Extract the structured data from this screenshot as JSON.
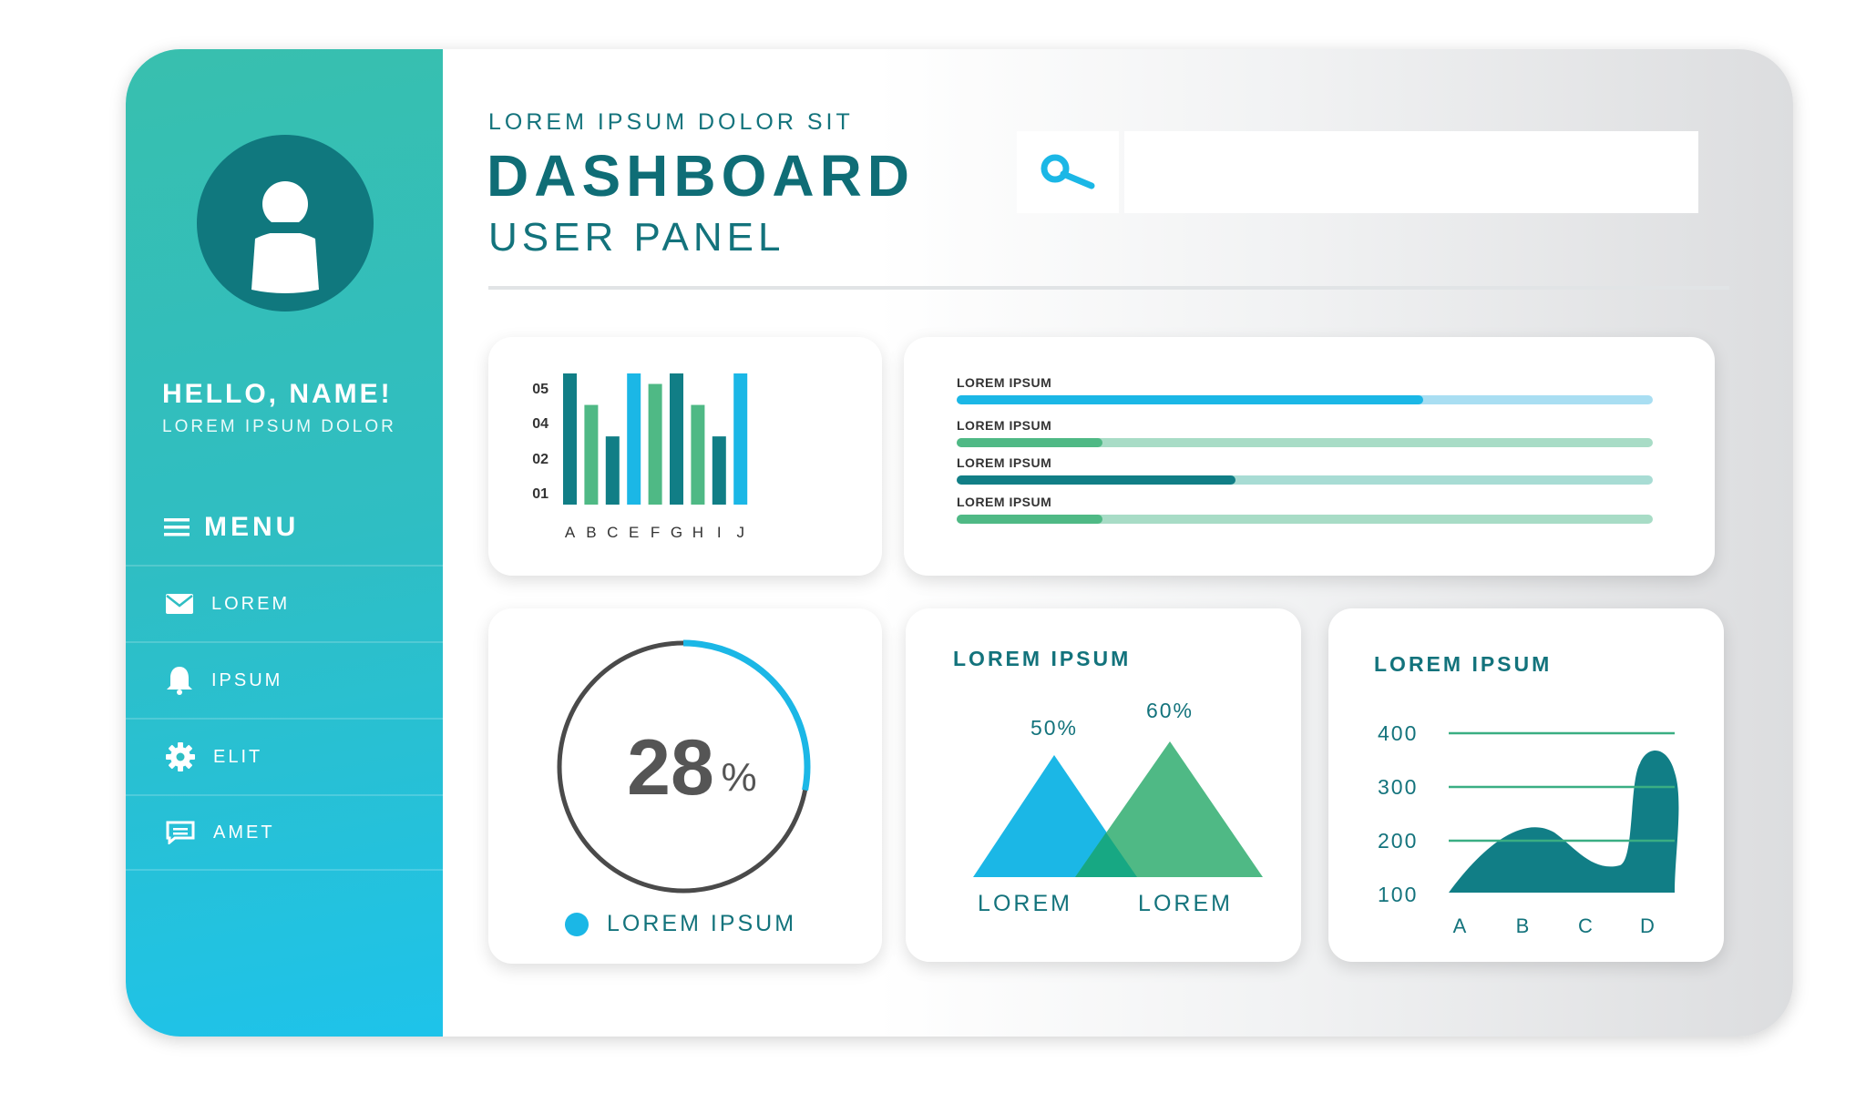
{
  "header": {
    "subtitle": "LOREM IPSUM DOLOR SIT",
    "title": "DASHBOARD",
    "title2": "USER PANEL",
    "search": {
      "value": "",
      "placeholder": ""
    }
  },
  "sidebar": {
    "greeting": "HELLO, NAME!",
    "greeting_sub": "LOREM IPSUM DOLOR",
    "menu_title": "MENU",
    "items": [
      {
        "label": "LOREM",
        "icon": "envelope-icon"
      },
      {
        "label": "IPSUM",
        "icon": "bell-icon"
      },
      {
        "label": "ELIT",
        "icon": "gear-icon"
      },
      {
        "label": "AMET",
        "icon": "chat-icon"
      }
    ]
  },
  "progress": {
    "bars": [
      {
        "label": "LOREM IPSUM",
        "value": 0.67,
        "fill": "#1bb7e6",
        "track": "#a9def2"
      },
      {
        "label": "LOREM IPSUM",
        "value": 0.21,
        "fill": "#4fb985",
        "track": "#a8dcc6"
      },
      {
        "label": "LOREM IPSUM",
        "value": 0.4,
        "fill": "#117e86",
        "track": "#a8dcd4"
      },
      {
        "label": "LOREM IPSUM",
        "value": 0.21,
        "fill": "#4fb985",
        "track": "#a8dcc6"
      }
    ]
  },
  "donut": {
    "value_text": "28",
    "unit": "%",
    "value": 0.28,
    "legend": "LOREM IPSUM",
    "accent": "#1bb7e6"
  },
  "colors": {
    "teal_dark": "#117e86",
    "green": "#4fb985",
    "blue": "#1bb7e6",
    "title": "#0f6d76"
  },
  "chart_data": [
    {
      "type": "bar",
      "categories": [
        "A",
        "B",
        "C",
        "E",
        "F",
        "G",
        "H",
        "I",
        "J"
      ],
      "values": [
        5,
        3.8,
        2.6,
        5,
        4.6,
        5,
        3.8,
        2.6,
        5
      ],
      "colors": [
        "#117e86",
        "#4fb985",
        "#117e86",
        "#1bb7e6",
        "#4fb985",
        "#117e86",
        "#4fb985",
        "#117e86",
        "#1bb7e6"
      ],
      "yticks": [
        "05",
        "04",
        "02",
        "01"
      ],
      "title": "",
      "xlabel": "",
      "ylabel": ""
    },
    {
      "type": "area",
      "title": "LOREM IPSUM",
      "categories": [
        "LOREM",
        "LOREM"
      ],
      "values": [
        50,
        60
      ],
      "data_labels": [
        "50%",
        "60%"
      ],
      "colors": [
        "#1bb7e6",
        "#4fb985"
      ],
      "overlap_color": "#17a883"
    },
    {
      "type": "area",
      "title": "LOREM IPSUM",
      "categories": [
        "A",
        "B",
        "C",
        "D"
      ],
      "yticks": [
        400,
        300,
        200,
        100
      ],
      "ylim": [
        100,
        400
      ],
      "grid": true,
      "fill": "#117e86",
      "grid_color": "#3aae83"
    }
  ]
}
